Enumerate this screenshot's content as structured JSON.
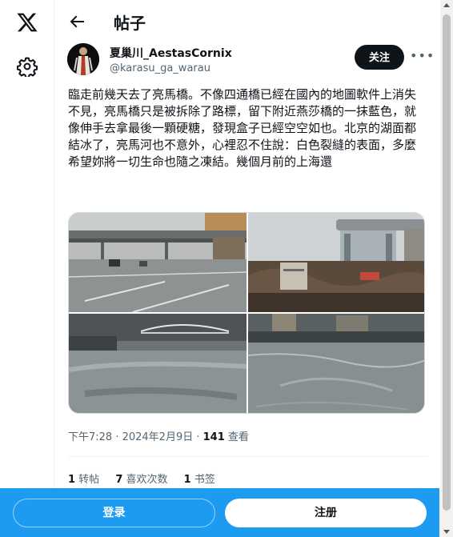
{
  "nav": {
    "logo_icon": "x-logo-icon",
    "settings_icon": "gear-icon"
  },
  "header": {
    "back_icon": "back-arrow-icon",
    "title": "帖子"
  },
  "author": {
    "name": "夏巢川_AestasCornix",
    "handle": "@karasu_ga_warau",
    "follow_label": "关注",
    "more_label": "•••"
  },
  "tweet": {
    "text": "臨走前幾天去了亮馬橋。不像四通橋已經在國內的地圖軟件上消失不見，亮馬橋只是被拆除了路標，留下附近燕莎橋的一抹藍色，就像伸手去拿最後一顆硬糖，發現盒子已經空空如也。北京的湖面都結冰了，亮馬河也不意外，心裡忍不住說：白色裂縫的表面，多麼希望妳將一切生命也隨之凍結。幾個月前的上海還",
    "time": "下午7:28 · 2024年2月9日 · ",
    "views_count": "141",
    "views_label": " 查看"
  },
  "stats": {
    "reposts_count": "1",
    "reposts_label": " 转帖",
    "likes_count": "7",
    "likes_label": " 喜欢次数",
    "bookmarks_count": "1",
    "bookmarks_label": " 书签"
  },
  "bottom_bar": {
    "login_label": "登录",
    "signup_label": "注册"
  },
  "colors": {
    "accent": "#1d9bf0",
    "text": "#0f1419",
    "muted": "#536471"
  }
}
